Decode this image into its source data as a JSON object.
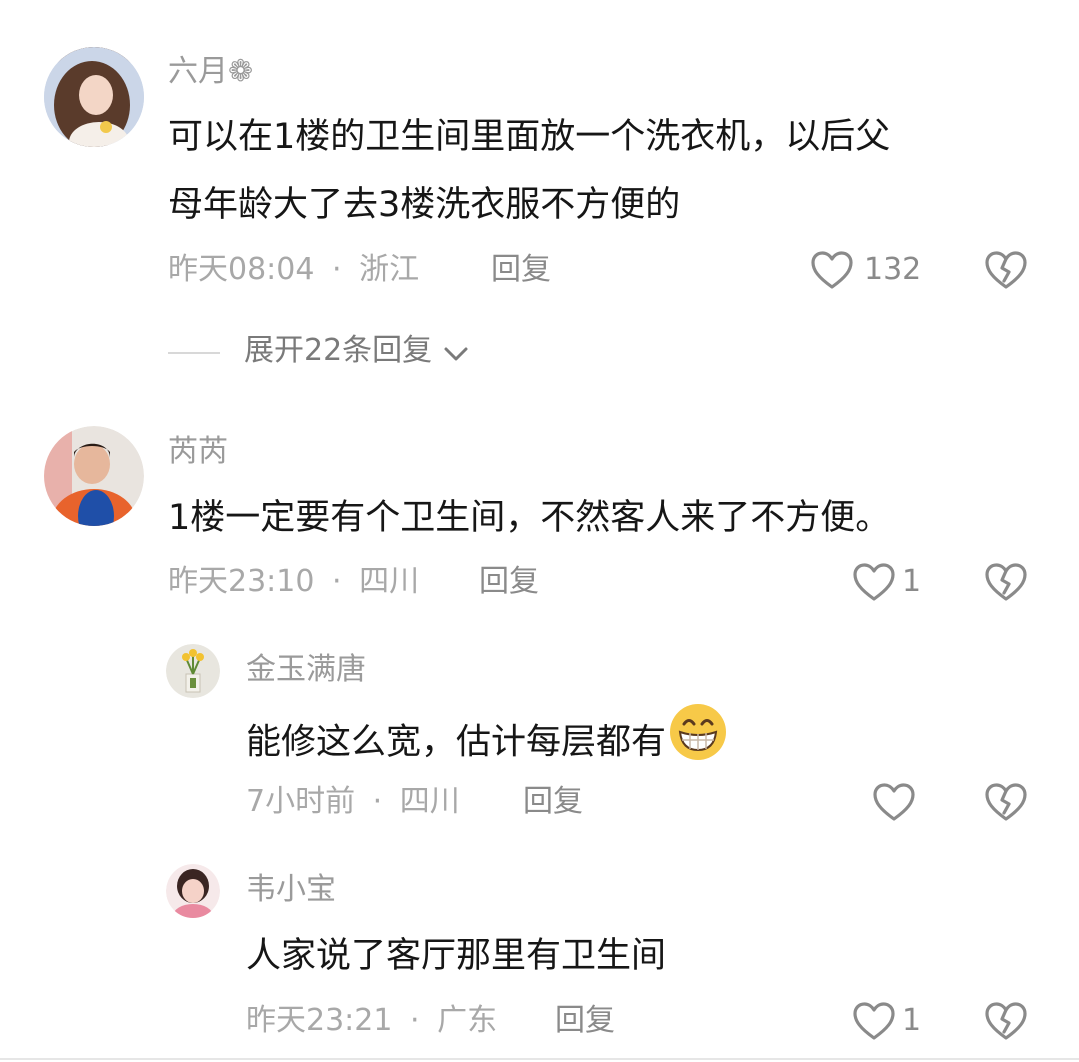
{
  "comments": [
    {
      "username": "六月❁",
      "text_line1": "可以在1楼的卫生间里面放一个洗衣机，以后父",
      "text_line2": "母年龄大了去3楼洗衣服不方便的",
      "time": "昨天08:04",
      "location": "浙江",
      "reply_label": "回复",
      "likes": "132",
      "expand_label": "展开22条回复"
    },
    {
      "username": "芮芮",
      "text": "1楼一定要有个卫生间，不然客人来了不方便。",
      "time": "昨天23:10",
      "location": "四川",
      "reply_label": "回复",
      "likes": "1"
    }
  ],
  "replies": [
    {
      "username": "金玉满唐",
      "text": "能修这么宽，估计每层都有",
      "emoji": "grinning-emoji",
      "time": "7小时前",
      "location": "四川",
      "reply_label": "回复",
      "likes": ""
    },
    {
      "username": "韦小宝",
      "text": "人家说了客厅那里有卫生间",
      "time": "昨天23:21",
      "location": "广东",
      "reply_label": "回复",
      "likes": "1"
    }
  ],
  "separator": "·",
  "colors": {
    "text": "#161616",
    "meta": "#a8a8a8",
    "accent_emoji": "#f7c948"
  }
}
